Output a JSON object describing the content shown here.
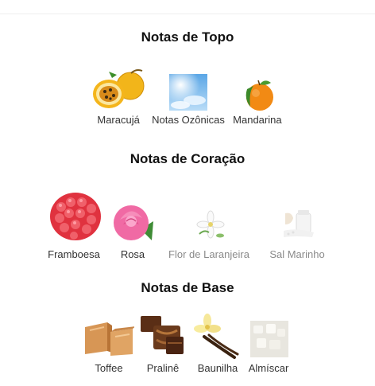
{
  "sections": [
    {
      "title": "Notas de Topo",
      "notes": [
        {
          "label": "Maracujá",
          "icon": "passion-fruit-icon"
        },
        {
          "label": "Notas Ozônicas",
          "icon": "sky-icon"
        },
        {
          "label": "Mandarina",
          "icon": "mandarin-icon"
        }
      ]
    },
    {
      "title": "Notas de Coração",
      "notes": [
        {
          "label": "Framboesa",
          "icon": "raspberry-icon"
        },
        {
          "label": "Rosa",
          "icon": "rose-icon"
        },
        {
          "label": "Flor de Laranjeira",
          "icon": "orange-blossom-icon"
        },
        {
          "label": "Sal Marinho",
          "icon": "sea-salt-icon"
        }
      ]
    },
    {
      "title": "Notas de Base",
      "notes": [
        {
          "label": "Toffee",
          "icon": "toffee-icon"
        },
        {
          "label": "Pralinê",
          "icon": "praline-icon"
        },
        {
          "label": "Baunilha",
          "icon": "vanilla-icon"
        },
        {
          "label": "Almíscar",
          "icon": "musk-icon"
        }
      ]
    }
  ]
}
